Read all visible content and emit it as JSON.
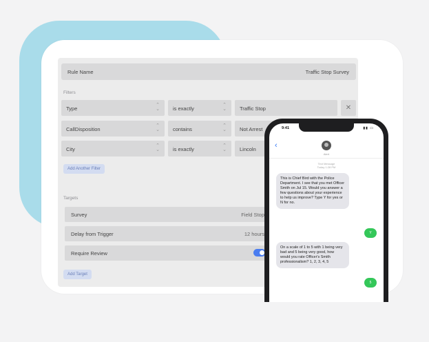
{
  "rule": {
    "name_label": "Rule Name",
    "name_value": "Traffic Stop Survey"
  },
  "filters": {
    "section_label": "Filters",
    "rows": [
      {
        "field": "Type",
        "operator": "is exactly",
        "value": "Traffic Stop"
      },
      {
        "field": "CallDisposition",
        "operator": "contains",
        "value": "Not Arrest"
      },
      {
        "field": "City",
        "operator": "is exactly",
        "value": "Lincoln"
      }
    ],
    "add_label": "Add Another Filter"
  },
  "targets": {
    "section_label": "Targets",
    "survey_label": "Survey",
    "survey_value": "Field Stop",
    "delay_label": "Delay from Trigger",
    "delay_value": "12 hours",
    "review_label": "Require Review",
    "review_enabled": true,
    "add_label": "Add Target"
  },
  "phone": {
    "time": "9:41",
    "contact": "Alert",
    "meta_line1": "Text Message",
    "meta_line2": "Today 1:28 PM",
    "msg1": "This is Chief Bird with the Police Department. I see that you met Officer Smith on Jul 15. Would you answer a few questions about your experience to help us improve? Type Y for yes or N for no.",
    "reply1": "Y",
    "msg2": "On a scale of 1 to 5 with 1 being very bad and 5 being very good, how would you rate Officer's Smith professionalism? 1, 2, 3, 4, 5",
    "reply2": "5"
  },
  "colors": {
    "accent_blob": "#a9dcea",
    "toggle": "#4a7df0",
    "imessage_green": "#34c759",
    "link_blue": "#3478f6"
  }
}
